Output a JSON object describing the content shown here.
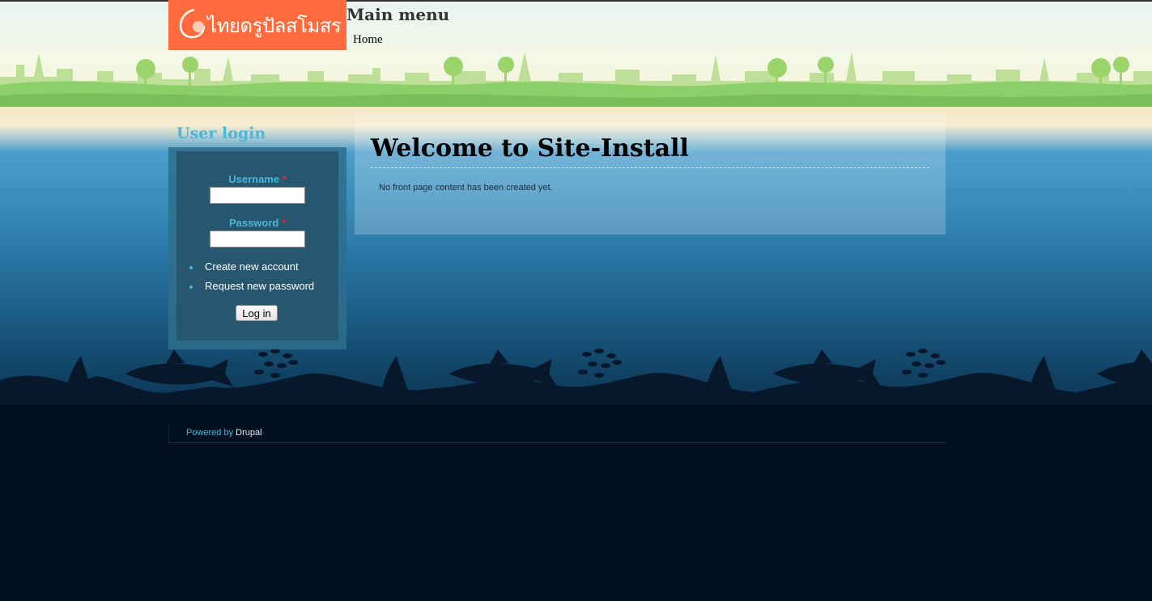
{
  "site": {
    "logo_text": "ไทยดรูปัลสโมสร"
  },
  "main_menu": {
    "title": "Main menu",
    "items": [
      {
        "label": "Home"
      }
    ]
  },
  "user_login": {
    "title": "User login",
    "username_label": "Username",
    "password_label": "Password",
    "required_marker": "*",
    "links": [
      {
        "label": "Create new account"
      },
      {
        "label": "Request new password"
      }
    ],
    "submit_label": "Log in"
  },
  "content": {
    "title": "Welcome to Site-Install",
    "message": "No front page content has been created yet."
  },
  "footer": {
    "powered_by": "Powered by",
    "drupal": "Drupal"
  },
  "colors": {
    "logo_background": "#ff6b3d",
    "accent": "#4ab6d8",
    "required": "#e0302f",
    "deep_sea": "#01101f"
  }
}
